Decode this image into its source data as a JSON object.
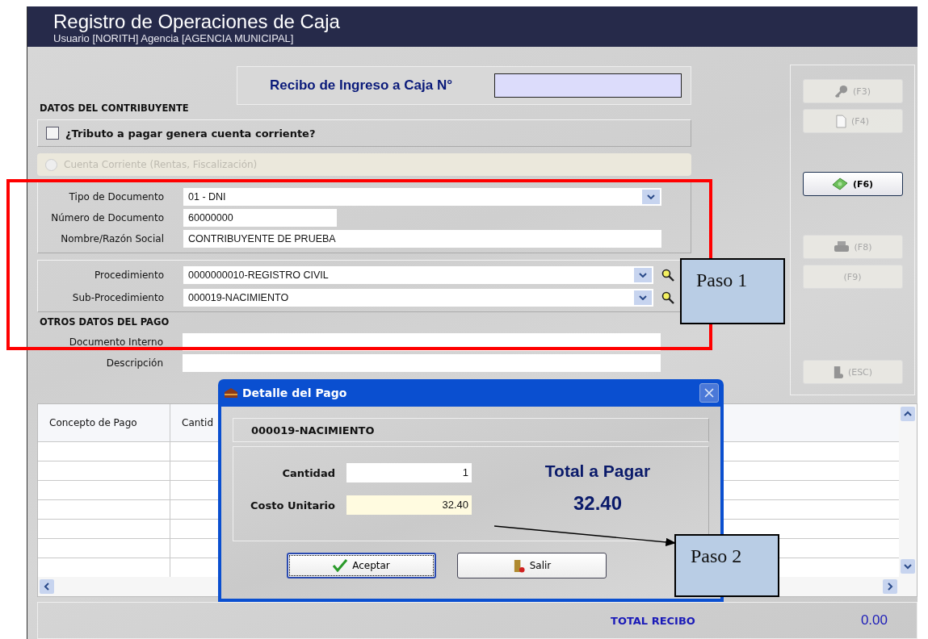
{
  "window": {
    "title": "Registro de Operaciones de Caja",
    "subtitle": "Usuario [NORITH] Agencia [AGENCIA MUNICIPAL]"
  },
  "receipt": {
    "label": "Recibo de Ingreso a Caja N°"
  },
  "contributor": {
    "heading": "DATOS DEL CONTRIBUYENTE",
    "checkbox": {
      "label": "¿Tributo a pagar genera cuenta corriente?",
      "checked": false
    },
    "radio": {
      "label": "Cuenta Corriente (Rentas, Fiscalización)",
      "selected": false,
      "disabled": true
    },
    "fields": [
      {
        "label": "Tipo de Documento",
        "value": "01 - DNI",
        "kind": "combo"
      },
      {
        "label": "Número de Documento",
        "value": "60000000",
        "kind": "short"
      },
      {
        "label": "Nombre/Razón Social",
        "value": "CONTRIBUYENTE DE PRUEBA",
        "kind": "text"
      }
    ],
    "procedures": [
      {
        "label": "Procedimiento",
        "value": "0000000010-REGISTRO CIVIL",
        "kind": "combo-search"
      },
      {
        "label": "Sub-Procedimiento",
        "value": "000019-NACIMIENTO",
        "kind": "combo-search"
      }
    ]
  },
  "payment": {
    "heading": "OTROS DATOS DEL PAGO",
    "fields": [
      {
        "label": "Documento Interno"
      },
      {
        "label": "Descripción"
      }
    ]
  },
  "table": {
    "columns": [
      "Concepto de Pago",
      "Cantid"
    ]
  },
  "total": {
    "label": "TOTAL RECIBO",
    "value": "0.00"
  },
  "actions": [
    {
      "label": "(F3)",
      "kind": "key",
      "disabled": true
    },
    {
      "label": "(F4)",
      "kind": "page",
      "disabled": true
    },
    {
      "label": "(F6)",
      "kind": "money",
      "disabled": false
    },
    {
      "label": "(F8)",
      "kind": "printer",
      "disabled": true
    },
    {
      "label": "(F9)",
      "kind": "plain",
      "disabled": true
    },
    {
      "label": "(ESC)",
      "kind": "door",
      "disabled": true
    }
  ],
  "dialog": {
    "title": "Detalle del Pago",
    "item": "000019-NACIMIENTO",
    "fields": [
      {
        "label": "Cantidad",
        "value": "1",
        "kind": "plain"
      },
      {
        "label": "Costo Unitario",
        "value": "32.40",
        "kind": "highlight"
      }
    ],
    "total_label": "Total a Pagar",
    "total_value": "32.40",
    "buttons": [
      {
        "label": "Aceptar",
        "kind": "accept",
        "focused": true
      },
      {
        "label": "Salir",
        "kind": "exit",
        "focused": false
      }
    ]
  },
  "annotations": [
    {
      "text": "Paso 1"
    },
    {
      "text": "Paso 2"
    }
  ]
}
